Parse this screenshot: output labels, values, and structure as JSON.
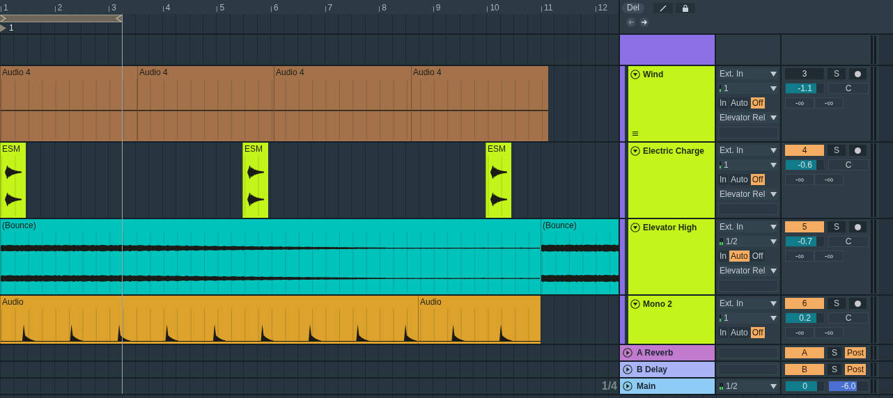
{
  "toolbar": {
    "delete_button": "Del"
  },
  "ruler": {
    "bars": [
      "1",
      "2",
      "3",
      "4",
      "5",
      "6",
      "7",
      "8",
      "9",
      "10",
      "11",
      "12"
    ]
  },
  "locator": {
    "label": "1"
  },
  "group_track": {
    "color": "#8b6fe4"
  },
  "tracks": [
    {
      "name": "Wind",
      "color": "#c3f51a",
      "handle": true,
      "kind": "flat",
      "clips": [
        {
          "name": "Audio 4",
          "color": "#a3714a"
        },
        {
          "name": "Audio 4",
          "color": "#a3714a"
        },
        {
          "name": "Audio 4",
          "color": "#a3714a"
        },
        {
          "name": "Audio 4",
          "color": "#a3714a"
        }
      ],
      "input": "Ext. In",
      "channel": "1",
      "monitor": [
        {
          "label": "In",
          "selected": false
        },
        {
          "label": "Auto",
          "selected": false
        },
        {
          "label": "Off",
          "selected": true
        }
      ],
      "output": "Elevator Rel",
      "number": "3",
      "active": false,
      "solo": "S",
      "volume": {
        "value": "-1.1",
        "level": 0.8
      },
      "pan": "C",
      "sends": [
        "-∞",
        "-∞"
      ]
    },
    {
      "name": "Electric Charge",
      "color": "#c3f51a",
      "handle": false,
      "kind": "hits",
      "clips": [
        {
          "name": "ESM",
          "color": "#c3f51a"
        },
        {
          "name": "ESM",
          "color": "#c3f51a"
        },
        {
          "name": "ESM",
          "color": "#c3f51a"
        }
      ],
      "input": "Ext. In",
      "channel": "1",
      "monitor": [
        {
          "label": "In",
          "selected": false
        },
        {
          "label": "Auto",
          "selected": false
        },
        {
          "label": "Off",
          "selected": true
        }
      ],
      "output": "Elevator Rel",
      "number": "4",
      "active": true,
      "solo": "S",
      "volume": {
        "value": "-0.6",
        "level": 0.8
      },
      "pan": "C",
      "sends": [
        "-∞",
        "-∞"
      ]
    },
    {
      "name": "Elevator High",
      "color": "#c3f51a",
      "handle": false,
      "kind": "bounce",
      "clips": [
        {
          "name": "(Bounce)",
          "color": "#00c4bc"
        },
        {
          "name": "(Bounce)",
          "color": "#00c4bc"
        }
      ],
      "input": "Ext. In",
      "channel": "1/2",
      "monitor": [
        {
          "label": "In",
          "selected": false
        },
        {
          "label": "Auto",
          "selected": true
        },
        {
          "label": "Off",
          "selected": false
        }
      ],
      "output": "Elevator Rel",
      "number": "5",
      "active": true,
      "solo": "S",
      "volume": {
        "value": "-0.7",
        "level": 0.8
      },
      "pan": "C",
      "sends": [
        "-∞",
        "-∞"
      ]
    },
    {
      "name": "Mono 2",
      "color": "#c3f51a",
      "handle": false,
      "kind": "spikes",
      "clips": [
        {
          "name": "Audio",
          "color": "#dca22c"
        },
        {
          "name": "Audio",
          "color": "#dca22c"
        }
      ],
      "input": "Ext. In",
      "channel": "1",
      "monitor": [
        {
          "label": "In",
          "selected": false
        },
        {
          "label": "Auto",
          "selected": false
        },
        {
          "label": "Off",
          "selected": true
        }
      ],
      "number": "6",
      "active": true,
      "solo": "S",
      "volume": {
        "value": "0.2",
        "level": 0.8
      },
      "pan": "C",
      "sends": [
        "-∞",
        "-∞"
      ]
    }
  ],
  "returns": [
    {
      "name": "A Reverb",
      "color": "#c07bcf",
      "letter": "A",
      "active": true,
      "solo": "S",
      "mode": "Post"
    },
    {
      "name": "B Delay",
      "color": "#a8b4f5",
      "letter": "B",
      "active": true,
      "solo": "S",
      "mode": "Post"
    }
  ],
  "main": {
    "name": "Main",
    "color": "#8ecbf5",
    "channel": "1/2",
    "volume": {
      "value": "0",
      "level": 0.82
    },
    "cue": {
      "value": "-6.0",
      "level": 0.72
    }
  },
  "grid_label": "1/4"
}
